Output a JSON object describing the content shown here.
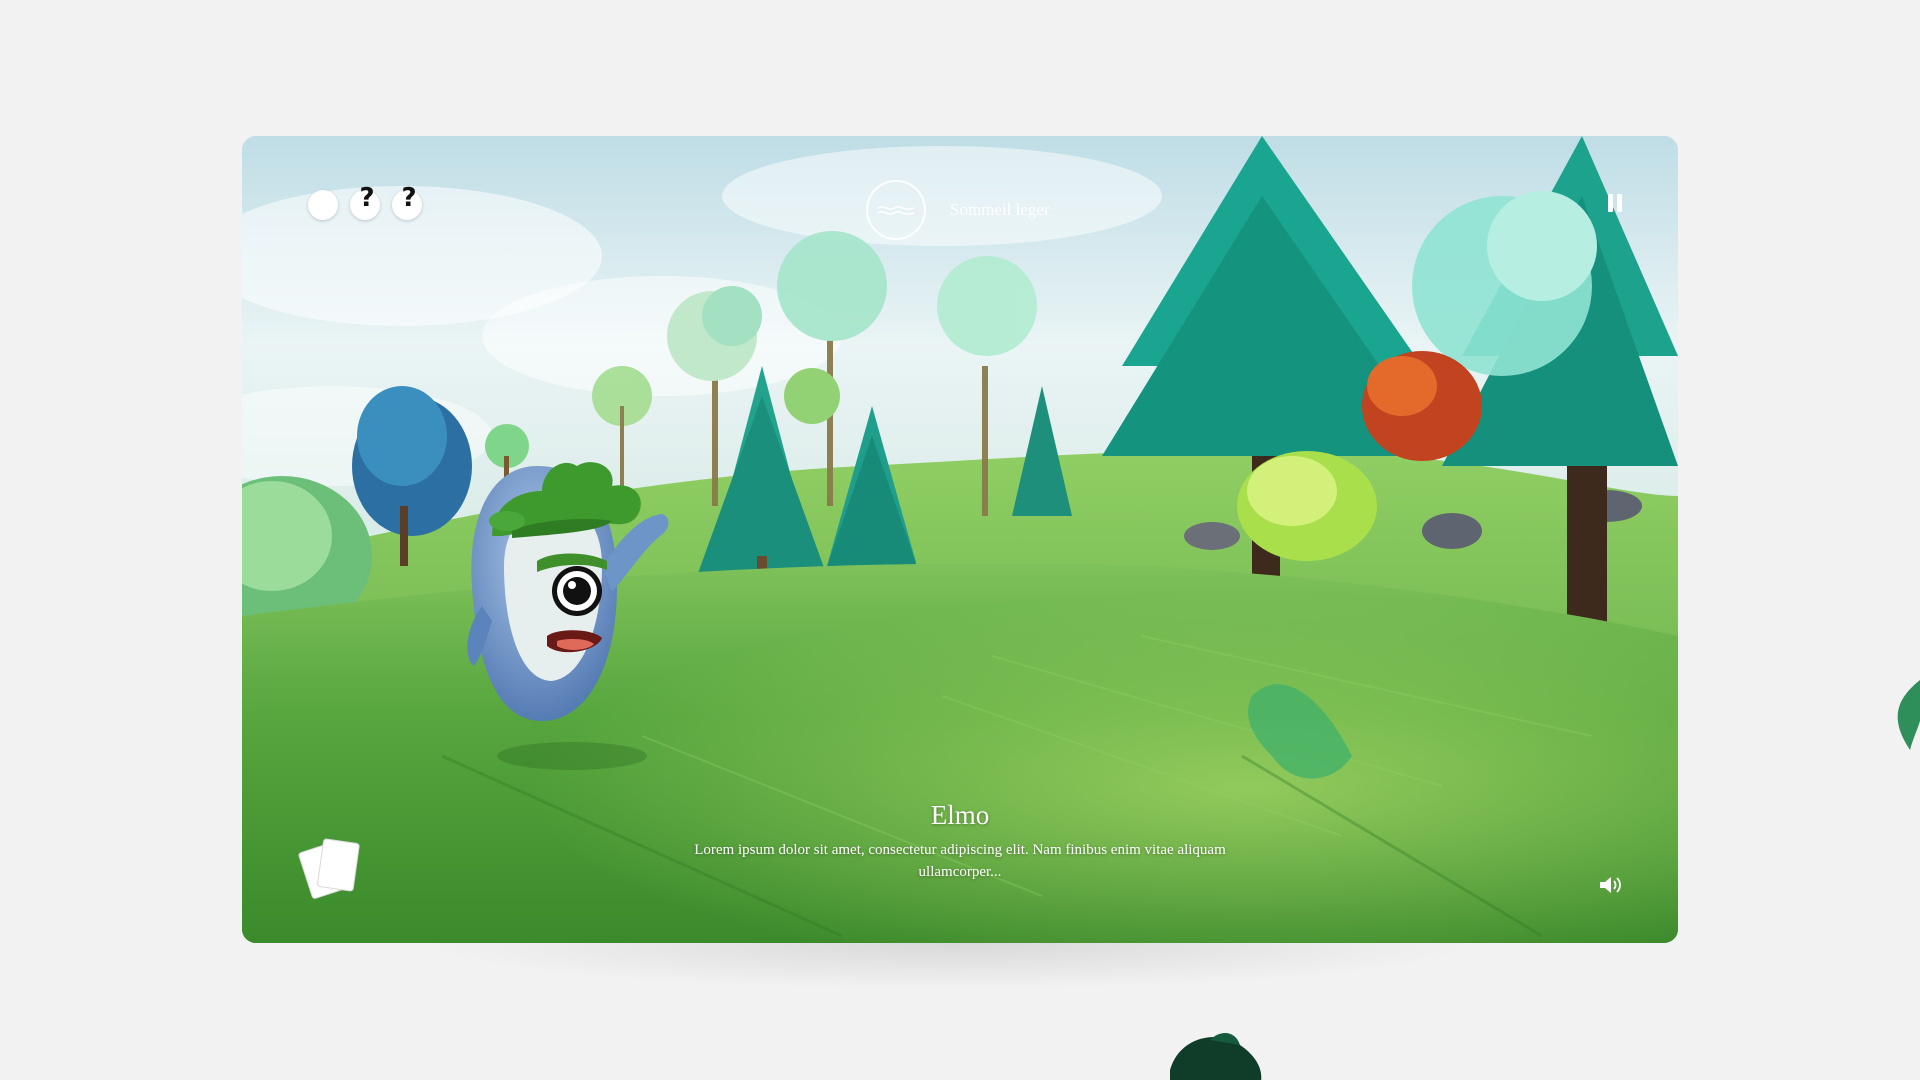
{
  "hud": {
    "lives": [
      {
        "state": "full",
        "glyph": ""
      },
      {
        "state": "unknown",
        "glyph": "?"
      },
      {
        "state": "unknown",
        "glyph": "?"
      }
    ],
    "level_icon": "wave-circle-icon",
    "level_label": "Sommeil leger",
    "pause_icon": "pause-icon",
    "cards_icon": "cards-icon",
    "sound_icon": "speaker-icon"
  },
  "dialogue": {
    "speaker": "Elmo",
    "text": "Lorem ipsum dolor sit amet, consectetur adipiscing elit. Nam finibus enim vitae aliquam ullamcorper..."
  },
  "colors": {
    "page_bg": "#f2f2f2",
    "grass": "#4f9c3a",
    "tree_teal": "#1f9e8c",
    "character_blue": "#6e95c8",
    "hud_white": "#ffffff"
  }
}
